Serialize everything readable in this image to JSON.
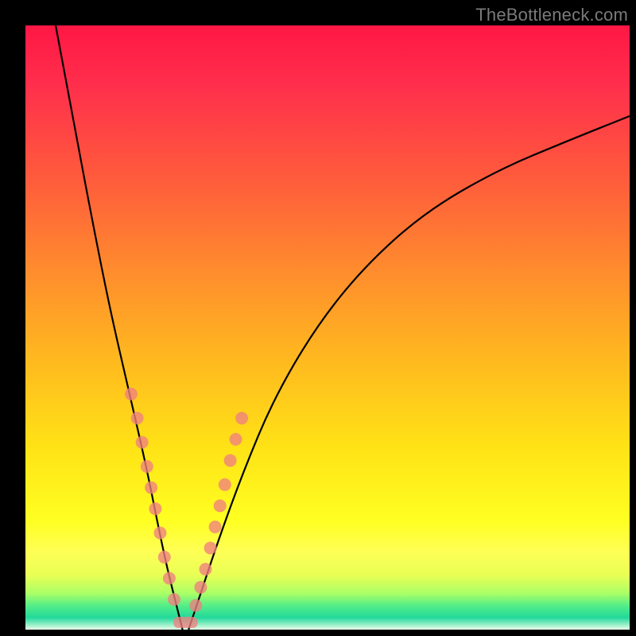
{
  "watermark": "TheBottleneck.com",
  "chart_data": {
    "type": "line",
    "title": "",
    "xlabel": "",
    "ylabel": "",
    "x_range": [
      0,
      100
    ],
    "y_range": [
      0,
      100
    ],
    "grid": false,
    "legend": false,
    "description": "Two-branch V-shaped curve on a vertical temperature-style gradient. Left branch is steep; right branch is shallower and asymptotes toward the top right. Minimum sits near x≈26 at y≈0. Axes unlabeled.",
    "series": [
      {
        "name": "left-branch",
        "x": [
          5,
          8,
          11,
          14,
          17,
          20,
          22,
          23.5,
          25,
          26
        ],
        "y": [
          100,
          84,
          68,
          53,
          40,
          27,
          17,
          10,
          4,
          0
        ]
      },
      {
        "name": "right-branch",
        "x": [
          27,
          29,
          32,
          36,
          41,
          48,
          56,
          66,
          78,
          90,
          100
        ],
        "y": [
          0,
          6,
          15,
          26,
          38,
          50,
          60,
          69,
          76,
          81,
          85
        ]
      }
    ],
    "markers": {
      "description": "Salmon-colored dots and a short horizontal bar clustered near the curve minimum on both branches",
      "left_dots": [
        {
          "x": 17.5,
          "y": 39
        },
        {
          "x": 18.5,
          "y": 35
        },
        {
          "x": 19.3,
          "y": 31
        },
        {
          "x": 20.1,
          "y": 27
        },
        {
          "x": 20.8,
          "y": 23.5
        },
        {
          "x": 21.5,
          "y": 20
        },
        {
          "x": 22.3,
          "y": 16
        },
        {
          "x": 23.0,
          "y": 12
        },
        {
          "x": 23.8,
          "y": 8.5
        },
        {
          "x": 24.6,
          "y": 5
        }
      ],
      "right_dots": [
        {
          "x": 28.2,
          "y": 4
        },
        {
          "x": 29.0,
          "y": 7
        },
        {
          "x": 29.8,
          "y": 10
        },
        {
          "x": 30.6,
          "y": 13.5
        },
        {
          "x": 31.4,
          "y": 17
        },
        {
          "x": 32.2,
          "y": 20.5
        },
        {
          "x": 33.0,
          "y": 24
        },
        {
          "x": 33.9,
          "y": 28
        },
        {
          "x": 34.8,
          "y": 31.5
        },
        {
          "x": 35.8,
          "y": 35
        }
      ],
      "bottom_bar": {
        "x1": 24.5,
        "x2": 28.5,
        "y": 1.2
      }
    }
  }
}
